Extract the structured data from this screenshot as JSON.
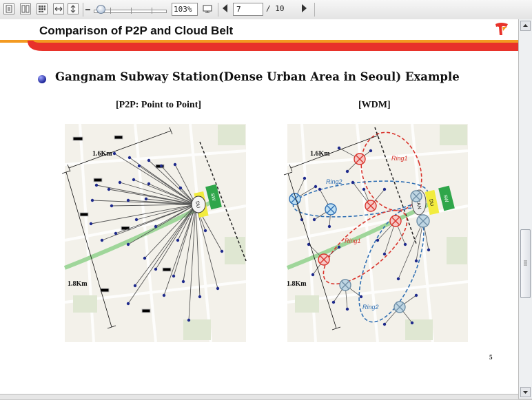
{
  "toolbar": {
    "view_buttons": [
      "single-page-icon",
      "two-page-icon",
      "thumbnails-icon",
      "fit-width-icon",
      "fit-height-icon"
    ],
    "zoom_value": "103%",
    "zoom_level_fraction": 0.1,
    "current_page": "7",
    "total_pages": "/ 10"
  },
  "slide": {
    "title": "Comparison of P2P and Cloud Belt",
    "heading": "Gangnam Subway Station(Dense Urban Area in Seoul) Example",
    "left_subtitle": "[P2P: Point to Point]",
    "right_subtitle": "[WDM]",
    "left_map": {
      "dist_top": "1.6Km",
      "dist_side": "1.8Km",
      "du_label": "DU",
      "sw_label": "SW"
    },
    "right_map": {
      "dist_top": "1.6Km",
      "dist_side": "1.8Km",
      "du_label": "DU",
      "sw_label": "SW",
      "scan_label": "SCAN",
      "ring1a": "Ring1",
      "ring1b": "Ring1",
      "ring2a": "Ring2",
      "ring2b": "Ring2"
    },
    "page_number": "5"
  },
  "colors": {
    "brand_red": "#e8322a",
    "brand_orange": "#f39a21",
    "ring1": "#d9332b",
    "ring2": "#2f6fb3"
  }
}
